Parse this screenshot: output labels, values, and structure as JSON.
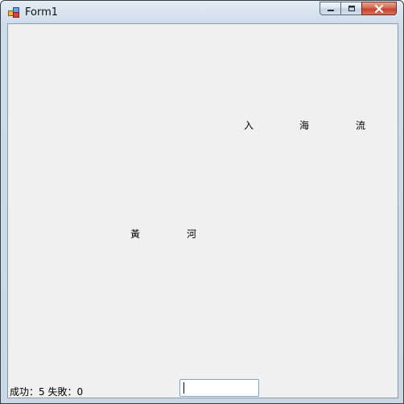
{
  "window": {
    "title": "Form1"
  },
  "characters_top": [
    "入",
    "海",
    "流"
  ],
  "characters_bottom": [
    "黃",
    "河"
  ],
  "status": {
    "success": "成功：5",
    "fail": "失敗：0"
  },
  "answer_input": {
    "value": ""
  }
}
